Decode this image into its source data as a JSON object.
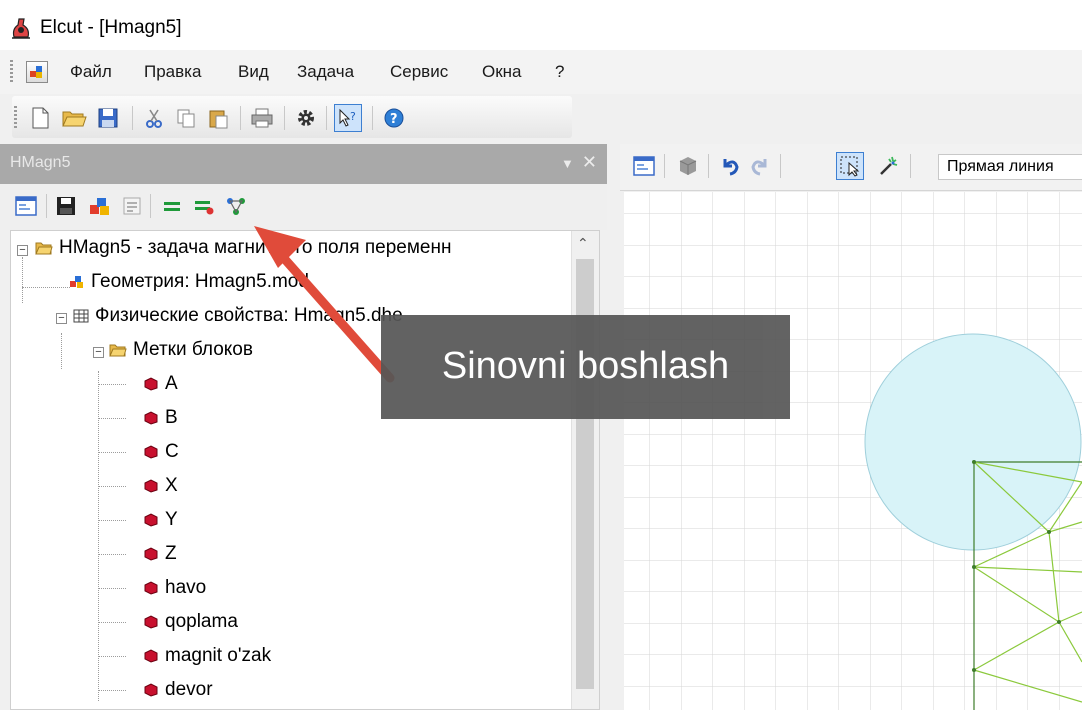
{
  "window": {
    "title": "Elcut - [Hmagn5]"
  },
  "menu": {
    "items": [
      {
        "label": "Файл"
      },
      {
        "label": "Правка"
      },
      {
        "label": "Вид"
      },
      {
        "label": "Задача"
      },
      {
        "label": "Сервис"
      },
      {
        "label": "Окна"
      },
      {
        "label": "?"
      }
    ]
  },
  "main_toolbar": {
    "buttons": [
      "new-document-icon",
      "open-folder-icon",
      "save-icon",
      "cut-icon",
      "copy-icon",
      "paste-icon",
      "print-icon",
      "settings-gear-icon",
      "context-help-icon",
      "help-icon"
    ]
  },
  "panel": {
    "title": "HMagn5",
    "toolbar_buttons": [
      "window-icon",
      "save-icon",
      "geometry-icon",
      "properties-icon",
      "solve-icon",
      "solve-all-icon",
      "coupling-icon"
    ]
  },
  "tree": {
    "root": "HMagn5 - задача магнитного поля переменн",
    "geometry": "Геометрия: Hmagn5.mod",
    "physics": "Физические свойства: Hmagn5.dhe",
    "block_labels_folder": "Метки блоков",
    "block_labels": [
      "A",
      "B",
      "C",
      "X",
      "Y",
      "Z",
      "havo",
      "qoplama",
      "magnit o'zak",
      "devor"
    ]
  },
  "document": {
    "toolbar_buttons": [
      "window-icon",
      "cube-icon",
      "undo-icon",
      "redo-icon",
      "select-icon",
      "magic-wand-icon"
    ],
    "line_type": "Прямая линия"
  },
  "annotation": {
    "text": "Sinovni boshlash"
  },
  "colors": {
    "panel_header": "#a9a9a9",
    "callout": "#575757",
    "arrow": "#e04b3a",
    "circle_fill": "#d8f3f8",
    "mesh": "#8bc93c"
  }
}
